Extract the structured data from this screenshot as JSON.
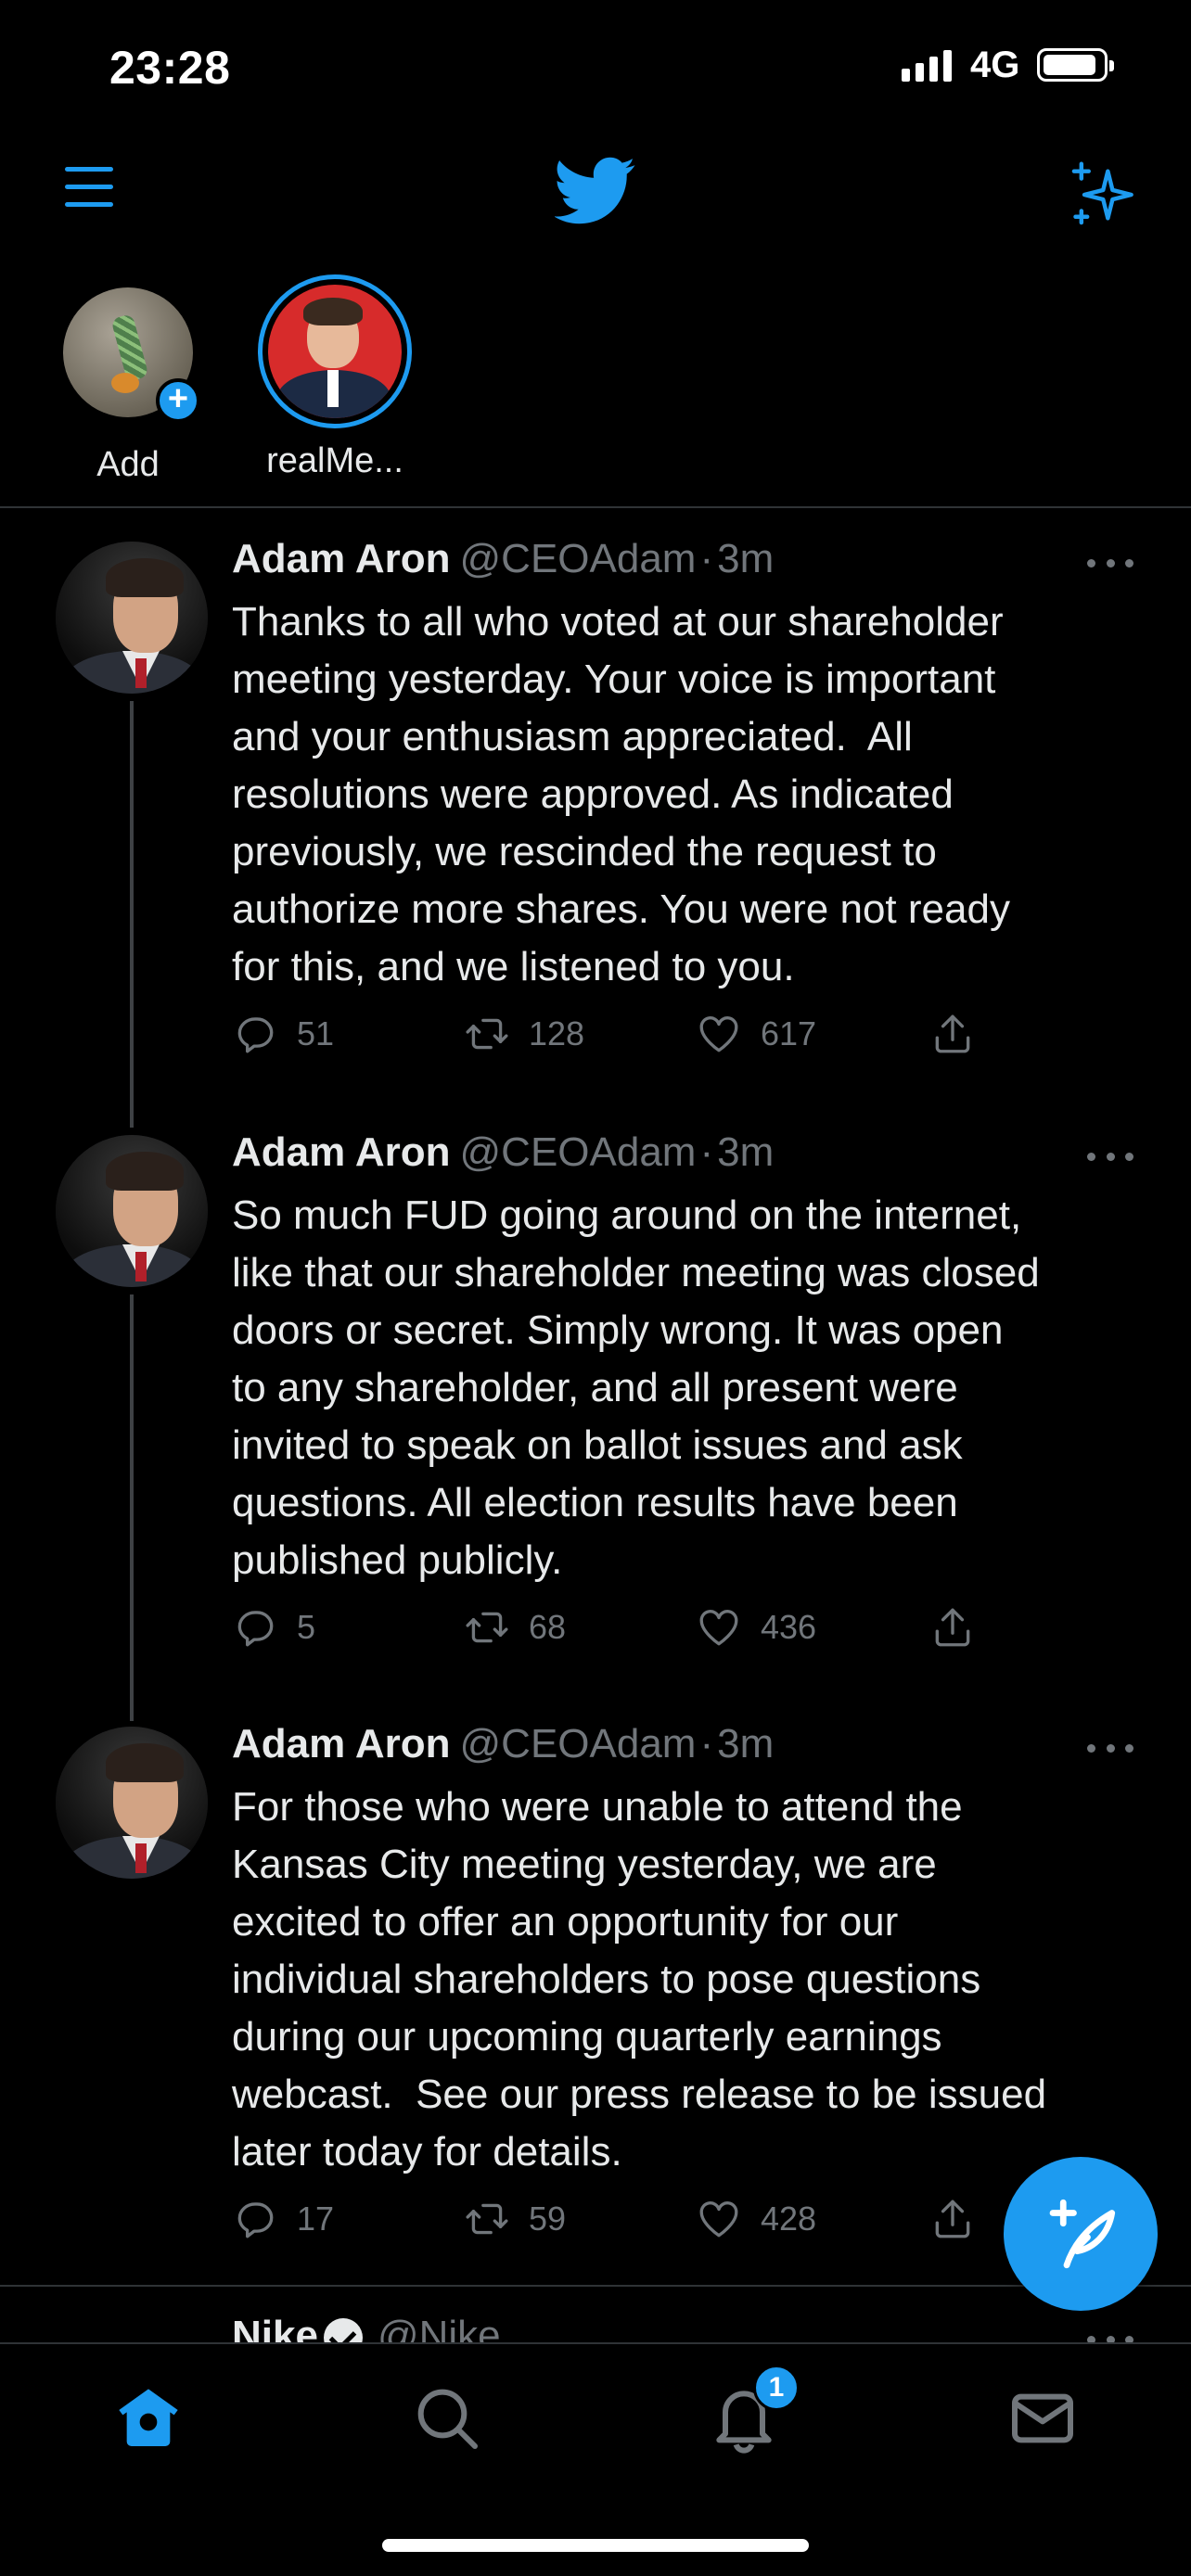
{
  "status_bar": {
    "time": "23:28",
    "network": "4G"
  },
  "fleets": [
    {
      "label": "Add"
    },
    {
      "label": "realMe..."
    }
  ],
  "tweets": [
    {
      "name": "Adam Aron",
      "handle": "@CEOAdam",
      "dot": "·",
      "time": "3m",
      "text": "Thanks to all who voted at our shareholder\nmeeting yesterday. Your voice is important\nand your enthusiasm appreciated.  All\nresolutions were approved. As indicated\npreviously, we rescinded the request to\nauthorize more shares. You were not ready\nfor this, and we listened to you.",
      "replies": "51",
      "retweets": "128",
      "likes": "617"
    },
    {
      "name": "Adam Aron",
      "handle": "@CEOAdam",
      "dot": "·",
      "time": "3m",
      "text": "So much FUD going around on the internet,\nlike that our shareholder meeting was closed\ndoors or secret. Simply wrong. It was open\nto any shareholder, and all present were\ninvited to speak on ballot issues and ask\nquestions. All election results have been\npublished publicly.",
      "replies": "5",
      "retweets": "68",
      "likes": "436"
    },
    {
      "name": "Adam Aron",
      "handle": "@CEOAdam",
      "dot": "·",
      "time": "3m",
      "text": "For those who were unable to attend the\nKansas City meeting yesterday, we are\nexcited to offer an opportunity for our\nindividual shareholders to pose questions\nduring our upcoming quarterly earnings\nwebcast.  See our press release to be issued\nlater today for details.",
      "replies": "17",
      "retweets": "59",
      "likes": "428"
    }
  ],
  "partial_tweet": {
    "name": "Nike",
    "handle": "@Nike"
  },
  "bottom_nav": {
    "notification_count": "1"
  },
  "colors": {
    "accent": "#1d9bf0",
    "background": "#000000",
    "muted": "#71767b"
  }
}
